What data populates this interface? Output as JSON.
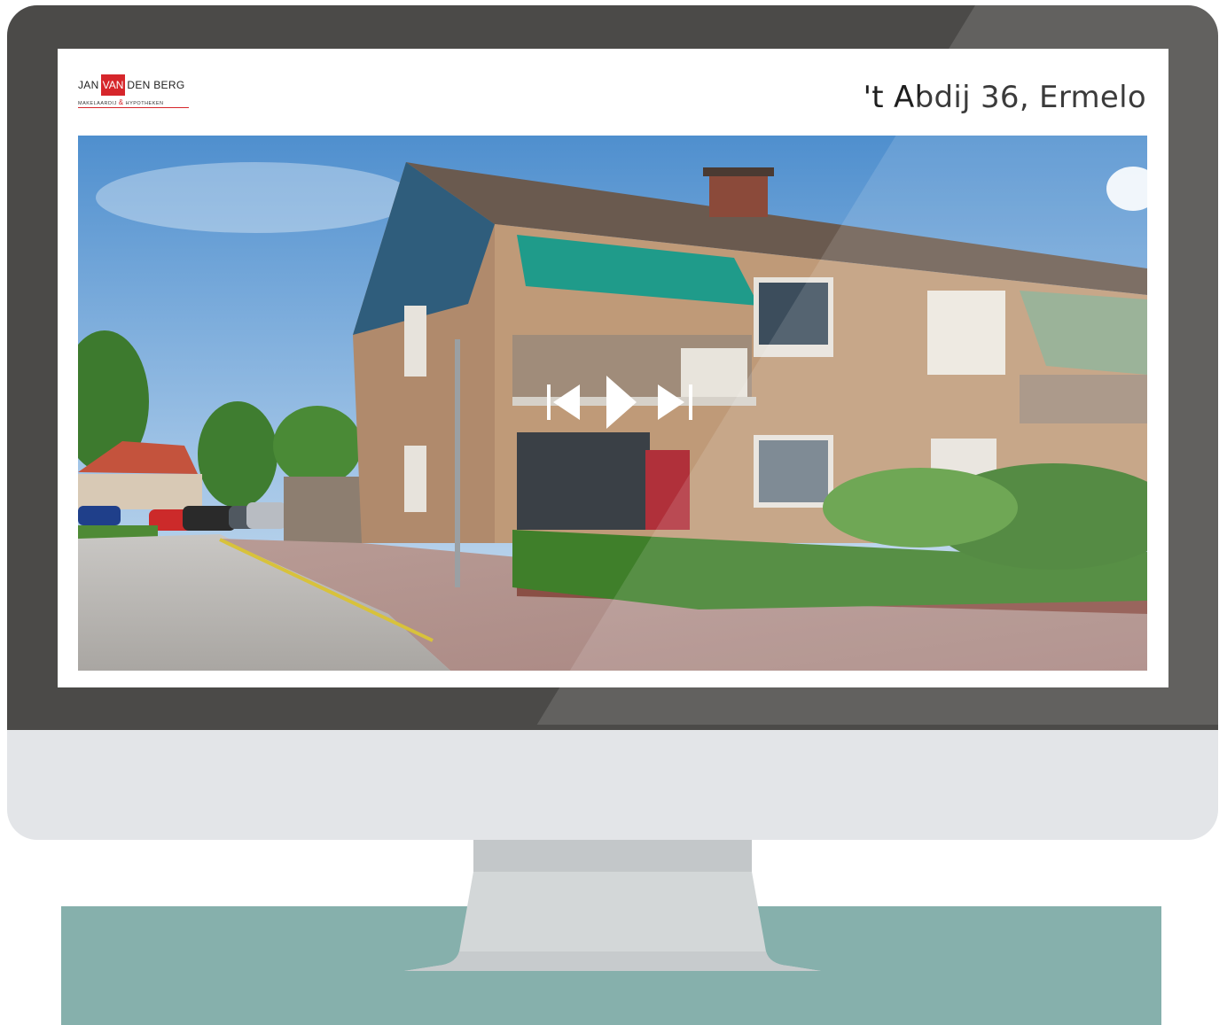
{
  "logo": {
    "word_left": "JAN",
    "word_mid": "VAN",
    "word_right": "DEN BERG",
    "sub_left": "MAKELAARDIJ",
    "sub_amp": "&",
    "sub_right": "HYPOTHEKEN"
  },
  "listing": {
    "address": "'t Abdij 36, Ermelo"
  },
  "slideshow": {
    "controls": [
      "previous-icon",
      "play-icon",
      "next-icon"
    ]
  },
  "colors": {
    "bezel": "#4b4a48",
    "chin": "#e3e5e8",
    "desk": "#86b0ac",
    "brand_red": "#d6262b"
  }
}
